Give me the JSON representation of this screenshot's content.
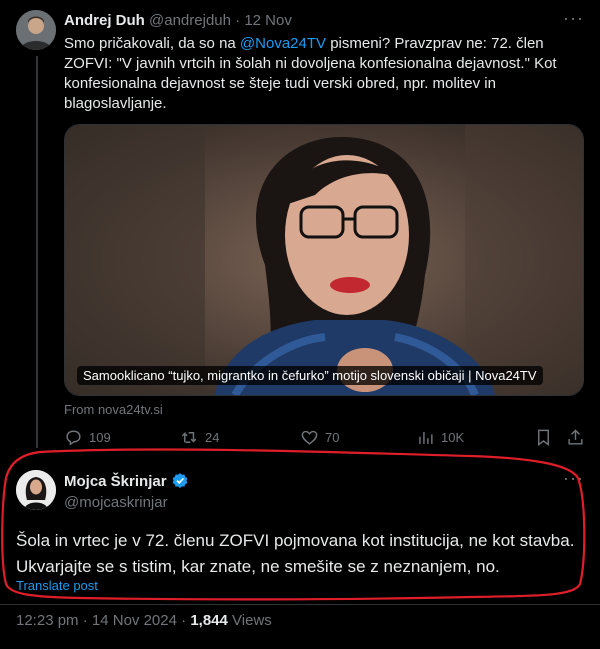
{
  "tweet1": {
    "name": "Andrej Duh",
    "handle": "@andrejduh",
    "separator": "·",
    "date": "12 Nov",
    "more": "···",
    "text_line1_pre": "Smo pričakovali, da so na ",
    "mention": "@Nova24TV",
    "text_line1_post": " pismeni? Pravzprav ne: 72. člen ZOFVI:",
    "text_rest": "\"V javnih vrtcih in šolah ni dovoljena konfesionalna dejavnost.\"  Kot konfesionalna dejavnost se šteje tudi verski obred, npr. molitev in blagoslavljanje.",
    "card_caption": "Samooklicano “tujko, migrantko in čefurko” motijo slovenski običaji | Nova24TV",
    "card_from": "From nova24tv.si",
    "actions": {
      "replies": "109",
      "reposts": "24",
      "likes": "70",
      "views": "10K"
    }
  },
  "tweet2": {
    "name": "Mojca Škrinjar",
    "handle": "@mojcaskrinjar",
    "more": "···",
    "text": "Šola in vrtec je v 72. členu ZOFVI pojmovana kot institucija, ne kot stavba. Ukvarjajte se s tistim, kar znate, ne smešite se z neznanjem, no.",
    "translate": "Translate post",
    "time": "12:23 pm",
    "separator": "·",
    "date": "14 Nov 2024",
    "views_count": "1,844",
    "views_label": "Views"
  },
  "colors": {
    "background": "#000000",
    "text": "#e7e9ea",
    "muted": "#71767b",
    "link": "#1d9bf0",
    "highlight": "#e01e2a",
    "verified": "#1d9bf0"
  }
}
